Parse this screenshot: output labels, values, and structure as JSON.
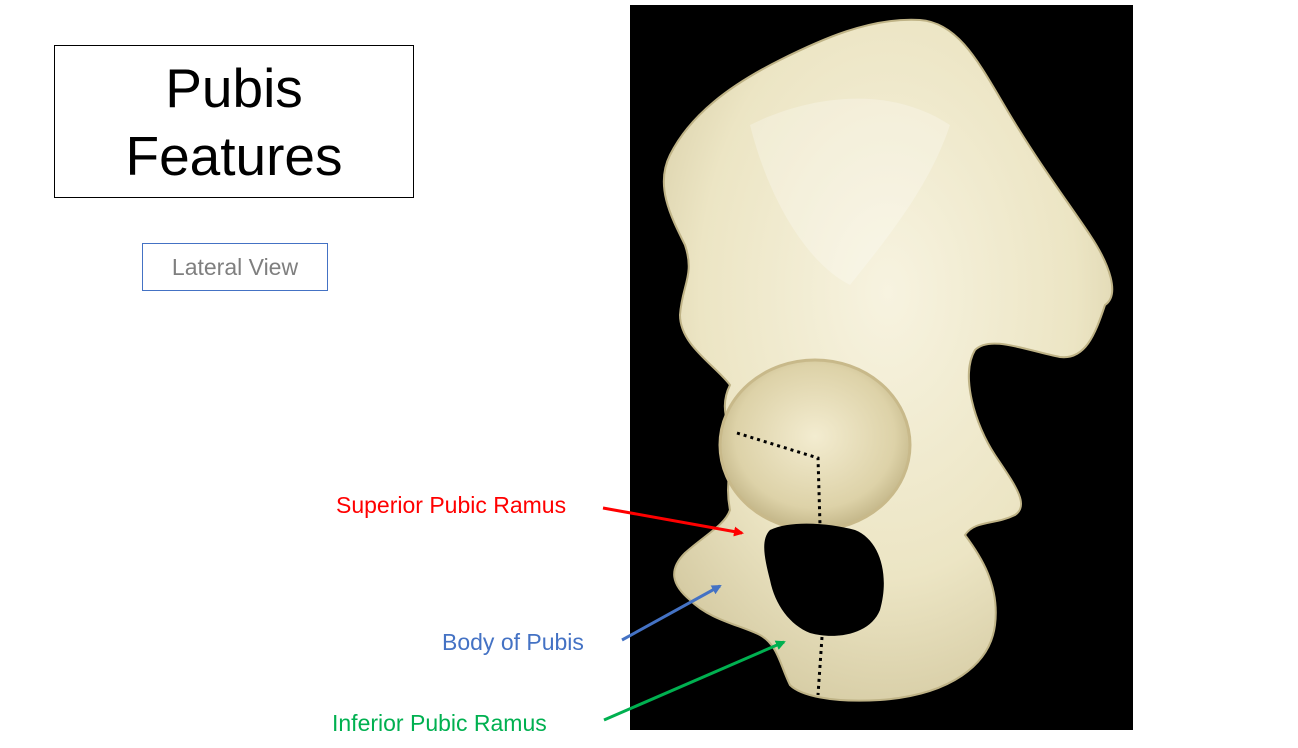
{
  "title": {
    "line1": "Pubis",
    "line2": "Features"
  },
  "subtitle": "Lateral View",
  "image": {
    "subject": "hip bone (os coxae), lateral view",
    "background_color": "#000000",
    "bone_color": "#f1ecd2"
  },
  "labels": {
    "superior": {
      "text": "Superior Pubic Ramus",
      "color": "#ff0000"
    },
    "body": {
      "text": "Body of Pubis",
      "color": "#4472c4"
    },
    "inferior": {
      "text": "Inferior Pubic Ramus",
      "color": "#00b050"
    }
  }
}
